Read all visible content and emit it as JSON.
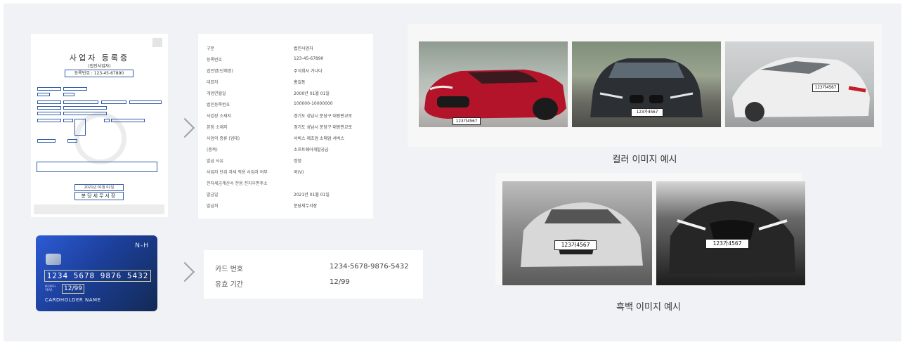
{
  "registration": {
    "title": "사업자 등록증",
    "type_label": "(법인사업자)",
    "reg_number": "등록번호 : 123-45-67890",
    "date": "2021년 01월 01일",
    "office": "분당세무서장"
  },
  "business_info": [
    {
      "label": "구분",
      "value": "법인사업자"
    },
    {
      "label": "등록번호",
      "value": "123-45-67890"
    },
    {
      "label": "법인명(단체명)",
      "value": "주식회사 가나다"
    },
    {
      "label": "대표자",
      "value": "홍길동"
    },
    {
      "label": "개업연월일",
      "value": "2000년 01월 01일"
    },
    {
      "label": "법인등록번호",
      "value": "100000-10000000"
    },
    {
      "label": "사업장 소재지",
      "value": "경기도 성남시 분당구 대왕판교로"
    },
    {
      "label": "본점 소재지",
      "value": "경기도 성남시 분당구 대왕판교로"
    },
    {
      "label": "사업의 종류 (업태)",
      "value": "서비스 제조업 소매업 서비스"
    },
    {
      "label": "(종목)",
      "value": "소프트웨어개발공급"
    },
    {
      "label": "발급 사유",
      "value": "정정"
    },
    {
      "label": "사업자 단위 과세 적용 사업자 여부",
      "value": "여(V)"
    },
    {
      "label": "전자세금계산서 전용 전자우편주소",
      "value": ""
    },
    {
      "label": "발급일",
      "value": "2021년 01월 01일"
    },
    {
      "label": "발급처",
      "value": "분당세무서장"
    }
  ],
  "card": {
    "brand": "N-H",
    "number": "1234 5678 9876 5432",
    "month_label": "MONTH",
    "year_label": "YEAR",
    "expiry": "12/99",
    "holder": "CARDHOLDER NAME"
  },
  "card_info": [
    {
      "label": "카드 번호",
      "value": "1234-5678-9876-5432"
    },
    {
      "label": "유효 기간",
      "value": "12/99"
    }
  ],
  "plates": {
    "red": "123가4567",
    "dark": "123가4567",
    "white": "123가4567",
    "mono1": "123가4567",
    "mono2": "123가4567"
  },
  "captions": {
    "color": "컬러 이미지 예시",
    "mono": "흑백 이미지 예시"
  },
  "colors": {
    "background": "#f1f2f5",
    "doc_box": "#2e5ca8",
    "card_blue": "#1c3f9a",
    "red_car": "#b3142a"
  }
}
